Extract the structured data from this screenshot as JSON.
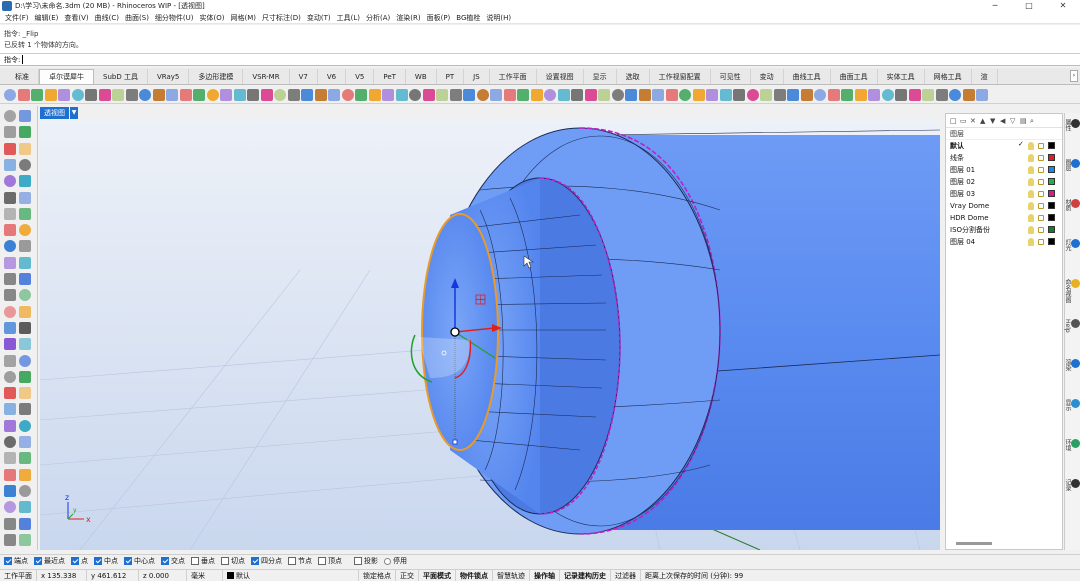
{
  "window": {
    "title": "D:\\学习\\未命名.3dm (20 MB) - Rhinoceros WIP - [透视图]",
    "minimize": "─",
    "maximize": "□",
    "close": "✕"
  },
  "menu": [
    "文件(F)",
    "编辑(E)",
    "查看(V)",
    "曲线(C)",
    "曲面(S)",
    "细分物件(U)",
    "实体(O)",
    "网格(M)",
    "尺寸标注(D)",
    "变动(T)",
    "工具(L)",
    "分析(A)",
    "渲染(R)",
    "面板(P)",
    "BG植栓",
    "说明(H)"
  ],
  "command_history": [
    "指令: _Flip",
    "已反转 1 个物体的方向。"
  ],
  "command_prompt": "指令:",
  "tabs": [
    "标准",
    "卓尔谟犀牛",
    "SubD 工具",
    "VRay5",
    "多边形建模",
    "VSR-MR",
    "V7",
    "V6",
    "V5",
    "PeT",
    "WB",
    "PT",
    "JS",
    "工作平面",
    "设置视图",
    "显示",
    "选取",
    "工作视窗配置",
    "可见性",
    "变动",
    "曲线工具",
    "曲面工具",
    "实体工具",
    "网格工具",
    "渲"
  ],
  "active_tab": "卓尔谟犀牛",
  "viewport": {
    "name": "透视图",
    "axis_x": "x",
    "axis_y": "y",
    "axis_z": "z"
  },
  "layers_panel": {
    "header": "图层",
    "layers": [
      {
        "name": "默认",
        "current": "✓",
        "color": "#000000"
      },
      {
        "name": "线条",
        "current": "",
        "color": "#e02020"
      },
      {
        "name": "图层 01",
        "current": "",
        "color": "#1e88e5"
      },
      {
        "name": "图层 02",
        "current": "",
        "color": "#22b14c"
      },
      {
        "name": "图层 03",
        "current": "",
        "color": "#d81b8c"
      },
      {
        "name": "Vray Dome",
        "current": "",
        "color": "#000000"
      },
      {
        "name": "HDR Dome",
        "current": "",
        "color": "#000000"
      },
      {
        "name": "ISO分割备份",
        "current": "",
        "color": "#1a7a2a"
      },
      {
        "name": "图层 04",
        "current": "",
        "color": "#000000"
      }
    ]
  },
  "side_tabs": [
    "属性",
    "图层",
    "材质",
    "灯光",
    "命名视图",
    "Help",
    "渲染",
    "显示",
    "环境",
    "记录"
  ],
  "osnap": [
    {
      "label": "端点",
      "on": true
    },
    {
      "label": "最近点",
      "on": true
    },
    {
      "label": "点",
      "on": true
    },
    {
      "label": "中点",
      "on": true
    },
    {
      "label": "中心点",
      "on": true
    },
    {
      "label": "交点",
      "on": true
    },
    {
      "label": "垂点",
      "on": false
    },
    {
      "label": "切点",
      "on": false
    },
    {
      "label": "四分点",
      "on": true
    },
    {
      "label": "节点",
      "on": false
    },
    {
      "label": "顶点",
      "on": false
    },
    {
      "label": "投影",
      "on": false
    },
    {
      "label": "停用",
      "radio": true
    }
  ],
  "status": {
    "cplane": "工作平面",
    "x": "x 135.338",
    "y": "y 461.612",
    "z": "z 0.000",
    "units": "毫米",
    "layer": "默认",
    "modes": [
      "锁定格点",
      "正交",
      "平面模式",
      "物件锁点",
      "智慧轨迹",
      "操作轴",
      "记录建构历史",
      "过滤器"
    ],
    "saved": "距离上次保存的时间 (分钟): 99"
  },
  "colors": {
    "accent": "#1f6fd1",
    "surface": "#5b8ef0",
    "viewport_bg": "#d6e1f2"
  }
}
